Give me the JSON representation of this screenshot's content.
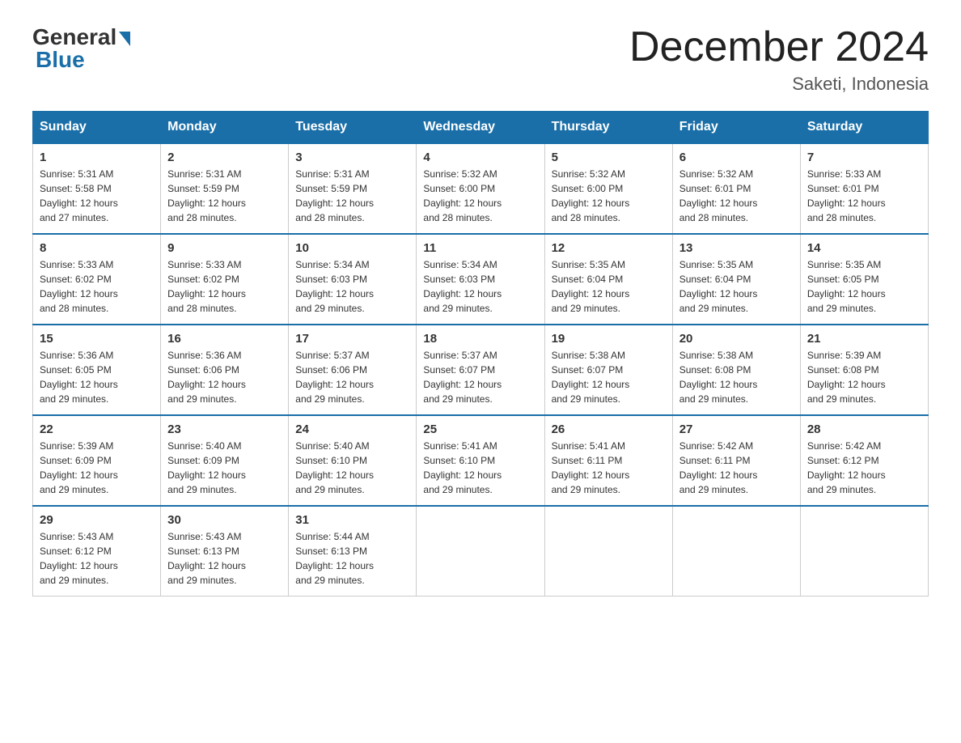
{
  "logo": {
    "general": "General",
    "blue": "Blue"
  },
  "title": "December 2024",
  "location": "Saketi, Indonesia",
  "days_of_week": [
    "Sunday",
    "Monday",
    "Tuesday",
    "Wednesday",
    "Thursday",
    "Friday",
    "Saturday"
  ],
  "weeks": [
    [
      {
        "day": "1",
        "info": "Sunrise: 5:31 AM\nSunset: 5:58 PM\nDaylight: 12 hours\nand 27 minutes."
      },
      {
        "day": "2",
        "info": "Sunrise: 5:31 AM\nSunset: 5:59 PM\nDaylight: 12 hours\nand 28 minutes."
      },
      {
        "day": "3",
        "info": "Sunrise: 5:31 AM\nSunset: 5:59 PM\nDaylight: 12 hours\nand 28 minutes."
      },
      {
        "day": "4",
        "info": "Sunrise: 5:32 AM\nSunset: 6:00 PM\nDaylight: 12 hours\nand 28 minutes."
      },
      {
        "day": "5",
        "info": "Sunrise: 5:32 AM\nSunset: 6:00 PM\nDaylight: 12 hours\nand 28 minutes."
      },
      {
        "day": "6",
        "info": "Sunrise: 5:32 AM\nSunset: 6:01 PM\nDaylight: 12 hours\nand 28 minutes."
      },
      {
        "day": "7",
        "info": "Sunrise: 5:33 AM\nSunset: 6:01 PM\nDaylight: 12 hours\nand 28 minutes."
      }
    ],
    [
      {
        "day": "8",
        "info": "Sunrise: 5:33 AM\nSunset: 6:02 PM\nDaylight: 12 hours\nand 28 minutes."
      },
      {
        "day": "9",
        "info": "Sunrise: 5:33 AM\nSunset: 6:02 PM\nDaylight: 12 hours\nand 28 minutes."
      },
      {
        "day": "10",
        "info": "Sunrise: 5:34 AM\nSunset: 6:03 PM\nDaylight: 12 hours\nand 29 minutes."
      },
      {
        "day": "11",
        "info": "Sunrise: 5:34 AM\nSunset: 6:03 PM\nDaylight: 12 hours\nand 29 minutes."
      },
      {
        "day": "12",
        "info": "Sunrise: 5:35 AM\nSunset: 6:04 PM\nDaylight: 12 hours\nand 29 minutes."
      },
      {
        "day": "13",
        "info": "Sunrise: 5:35 AM\nSunset: 6:04 PM\nDaylight: 12 hours\nand 29 minutes."
      },
      {
        "day": "14",
        "info": "Sunrise: 5:35 AM\nSunset: 6:05 PM\nDaylight: 12 hours\nand 29 minutes."
      }
    ],
    [
      {
        "day": "15",
        "info": "Sunrise: 5:36 AM\nSunset: 6:05 PM\nDaylight: 12 hours\nand 29 minutes."
      },
      {
        "day": "16",
        "info": "Sunrise: 5:36 AM\nSunset: 6:06 PM\nDaylight: 12 hours\nand 29 minutes."
      },
      {
        "day": "17",
        "info": "Sunrise: 5:37 AM\nSunset: 6:06 PM\nDaylight: 12 hours\nand 29 minutes."
      },
      {
        "day": "18",
        "info": "Sunrise: 5:37 AM\nSunset: 6:07 PM\nDaylight: 12 hours\nand 29 minutes."
      },
      {
        "day": "19",
        "info": "Sunrise: 5:38 AM\nSunset: 6:07 PM\nDaylight: 12 hours\nand 29 minutes."
      },
      {
        "day": "20",
        "info": "Sunrise: 5:38 AM\nSunset: 6:08 PM\nDaylight: 12 hours\nand 29 minutes."
      },
      {
        "day": "21",
        "info": "Sunrise: 5:39 AM\nSunset: 6:08 PM\nDaylight: 12 hours\nand 29 minutes."
      }
    ],
    [
      {
        "day": "22",
        "info": "Sunrise: 5:39 AM\nSunset: 6:09 PM\nDaylight: 12 hours\nand 29 minutes."
      },
      {
        "day": "23",
        "info": "Sunrise: 5:40 AM\nSunset: 6:09 PM\nDaylight: 12 hours\nand 29 minutes."
      },
      {
        "day": "24",
        "info": "Sunrise: 5:40 AM\nSunset: 6:10 PM\nDaylight: 12 hours\nand 29 minutes."
      },
      {
        "day": "25",
        "info": "Sunrise: 5:41 AM\nSunset: 6:10 PM\nDaylight: 12 hours\nand 29 minutes."
      },
      {
        "day": "26",
        "info": "Sunrise: 5:41 AM\nSunset: 6:11 PM\nDaylight: 12 hours\nand 29 minutes."
      },
      {
        "day": "27",
        "info": "Sunrise: 5:42 AM\nSunset: 6:11 PM\nDaylight: 12 hours\nand 29 minutes."
      },
      {
        "day": "28",
        "info": "Sunrise: 5:42 AM\nSunset: 6:12 PM\nDaylight: 12 hours\nand 29 minutes."
      }
    ],
    [
      {
        "day": "29",
        "info": "Sunrise: 5:43 AM\nSunset: 6:12 PM\nDaylight: 12 hours\nand 29 minutes."
      },
      {
        "day": "30",
        "info": "Sunrise: 5:43 AM\nSunset: 6:13 PM\nDaylight: 12 hours\nand 29 minutes."
      },
      {
        "day": "31",
        "info": "Sunrise: 5:44 AM\nSunset: 6:13 PM\nDaylight: 12 hours\nand 29 minutes."
      },
      null,
      null,
      null,
      null
    ]
  ]
}
